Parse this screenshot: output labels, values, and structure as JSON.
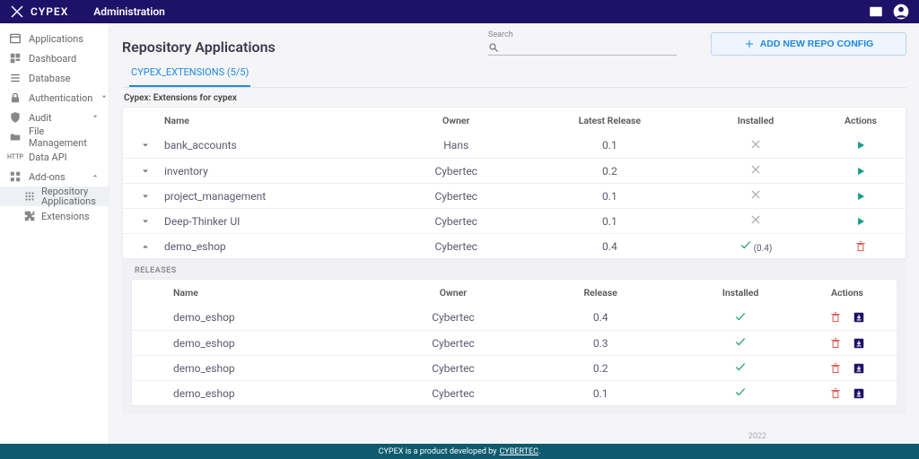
{
  "header": {
    "brand": "CYPEX",
    "title": "Administration"
  },
  "sidebar": {
    "items": [
      {
        "id": "applications",
        "label": "Applications",
        "icon": "window",
        "chev": false
      },
      {
        "id": "dashboard",
        "label": "Dashboard",
        "icon": "grid",
        "chev": false
      },
      {
        "id": "database",
        "label": "Database",
        "icon": "stack",
        "chev": false
      },
      {
        "id": "authentication",
        "label": "Authentication",
        "icon": "lock",
        "chev": true
      },
      {
        "id": "audit",
        "label": "Audit",
        "icon": "shield",
        "chev": true
      },
      {
        "id": "file-management",
        "label": "File Management",
        "icon": "folder",
        "chev": false
      },
      {
        "id": "data-api",
        "label": "Data API",
        "icon": "http",
        "chev": false
      },
      {
        "id": "addons",
        "label": "Add-ons",
        "icon": "addons",
        "chev": true,
        "expanded": true
      }
    ],
    "addons_subitems": [
      {
        "id": "repo-apps",
        "label": "Repository Applications",
        "icon": "apps",
        "active": true
      },
      {
        "id": "extensions",
        "label": "Extensions",
        "icon": "puzzle",
        "active": false
      }
    ]
  },
  "page": {
    "title": "Repository Applications",
    "search_label": "Search",
    "search_value": "",
    "add_button": "ADD NEW REPO CONFIG",
    "tab_label": "CYPEX_EXTENSIONS (5/5)",
    "caption": "Cypex: Extensions for cypex"
  },
  "table": {
    "columns": {
      "name": "Name",
      "owner": "Owner",
      "latest_release": "Latest Release",
      "installed": "Installed",
      "actions": "Actions"
    },
    "rows": [
      {
        "name": "bank_accounts",
        "owner": "Hans",
        "latest": "0.1",
        "installed": false,
        "expanded": false
      },
      {
        "name": "inventory",
        "owner": "Cybertec",
        "latest": "0.2",
        "installed": false,
        "expanded": false
      },
      {
        "name": "project_management",
        "owner": "Cybertec",
        "latest": "0.1",
        "installed": false,
        "expanded": false
      },
      {
        "name": "Deep-Thinker UI",
        "owner": "Cybertec",
        "latest": "0.1",
        "installed": false,
        "expanded": false
      },
      {
        "name": "demo_eshop",
        "owner": "Cybertec",
        "latest": "0.4",
        "installed": true,
        "installed_version": "(0.4)",
        "expanded": true
      }
    ]
  },
  "releases": {
    "label": "RELEASES",
    "columns": {
      "name": "Name",
      "owner": "Owner",
      "release": "Release",
      "installed": "Installed",
      "actions": "Actions"
    },
    "rows": [
      {
        "name": "demo_eshop",
        "owner": "Cybertec",
        "release": "0.4",
        "installed": true
      },
      {
        "name": "demo_eshop",
        "owner": "Cybertec",
        "release": "0.3",
        "installed": true
      },
      {
        "name": "demo_eshop",
        "owner": "Cybertec",
        "release": "0.2",
        "installed": true
      },
      {
        "name": "demo_eshop",
        "owner": "Cybertec",
        "release": "0.1",
        "installed": true
      }
    ]
  },
  "footer": {
    "text": "CYPEX is a product developed by",
    "link_text": "CYBERTEC",
    "trailing": ".",
    "year": "2022"
  }
}
